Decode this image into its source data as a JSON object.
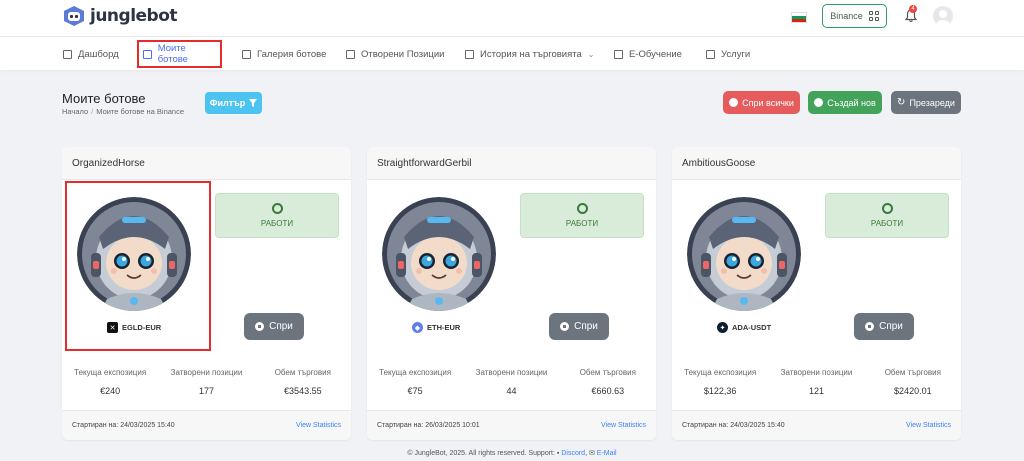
{
  "brand": {
    "name": "junglebot"
  },
  "header": {
    "exchange_label": "Binance",
    "notifications_count": "4"
  },
  "nav": [
    {
      "label": "Дашборд",
      "icon": "dashboard-icon"
    },
    {
      "label": "Моите ботове",
      "icon": "cube-icon",
      "active": true
    },
    {
      "label": "Галерия ботове",
      "icon": "bag-icon"
    },
    {
      "label": "Отворени Позиции",
      "icon": "box-icon"
    },
    {
      "label": "История на търговията",
      "icon": "swap-icon"
    },
    {
      "label": "Е-Обучение",
      "icon": "book-icon"
    },
    {
      "label": "Услуги",
      "icon": "layers-icon"
    }
  ],
  "page": {
    "title": "Моите ботове",
    "breadcrumb": [
      "Начало",
      "Моите ботове на Binance"
    ],
    "filter_label": "Филтър",
    "stop_all_label": "Спри всички",
    "create_label": "Създай нов",
    "reload_label": "Презареди"
  },
  "labels": {
    "status": "РАБОТИ",
    "stop": "Спри",
    "exposure": "Текуща експозиция",
    "closed": "Затворени позиции",
    "volume": "Обем търговия",
    "started": "Стартиран на:",
    "view_stats": "View Statistics"
  },
  "bots": [
    {
      "name": "OrganizedHorse",
      "pair": "EGLD-EUR",
      "exposure": "€240",
      "closed": "177",
      "volume": "€3543.55",
      "started": "24/03/2025 15:40"
    },
    {
      "name": "StraightforwardGerbil",
      "pair": "ETH-EUR",
      "exposure": "€75",
      "closed": "44",
      "volume": "€660.63",
      "started": "26/03/2025 10:01"
    },
    {
      "name": "AmbitiousGoose",
      "pair": "ADA-USDT",
      "exposure": "$122,36",
      "closed": "121",
      "volume": "$2420.01",
      "started": "24/03/2025 15:40"
    }
  ],
  "footer": {
    "text": "© JungleBot, 2025. All rights reserved. Support:",
    "discord": "Discord",
    "email": "E-Mail"
  },
  "colors": {
    "primary": "#4a6ff0",
    "running": "#d9ecd9",
    "danger": "#e65b5b",
    "success": "#43a35b",
    "secondary": "#6c757d",
    "info": "#4cc3f0"
  }
}
